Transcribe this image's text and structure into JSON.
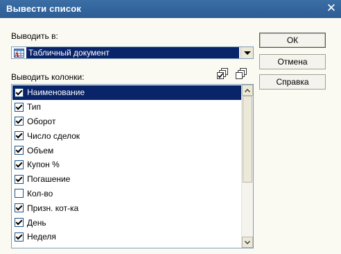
{
  "window": {
    "title": "Вывести список"
  },
  "output_to": {
    "label": "Выводить в:",
    "selected": "Табличный документ"
  },
  "columns": {
    "label": "Выводить колонки:",
    "items": [
      {
        "label": "Наименование",
        "checked": true,
        "selected": true
      },
      {
        "label": "Тип",
        "checked": true,
        "selected": false
      },
      {
        "label": "Оборот",
        "checked": true,
        "selected": false
      },
      {
        "label": "Число сделок",
        "checked": true,
        "selected": false
      },
      {
        "label": "Объем",
        "checked": true,
        "selected": false
      },
      {
        "label": "Купон %",
        "checked": true,
        "selected": false
      },
      {
        "label": "Погашение",
        "checked": true,
        "selected": false
      },
      {
        "label": "Кол-во",
        "checked": false,
        "selected": false
      },
      {
        "label": "Призн. кот-ка",
        "checked": true,
        "selected": false
      },
      {
        "label": "День",
        "checked": true,
        "selected": false
      },
      {
        "label": "Неделя",
        "checked": true,
        "selected": false
      }
    ]
  },
  "buttons": {
    "ok": "ОК",
    "cancel": "Отмена",
    "help": "Справка"
  },
  "colors": {
    "titlebar": "#2d5d94",
    "selection": "#0a246a",
    "dialog_bg": "#fbfaf2"
  }
}
